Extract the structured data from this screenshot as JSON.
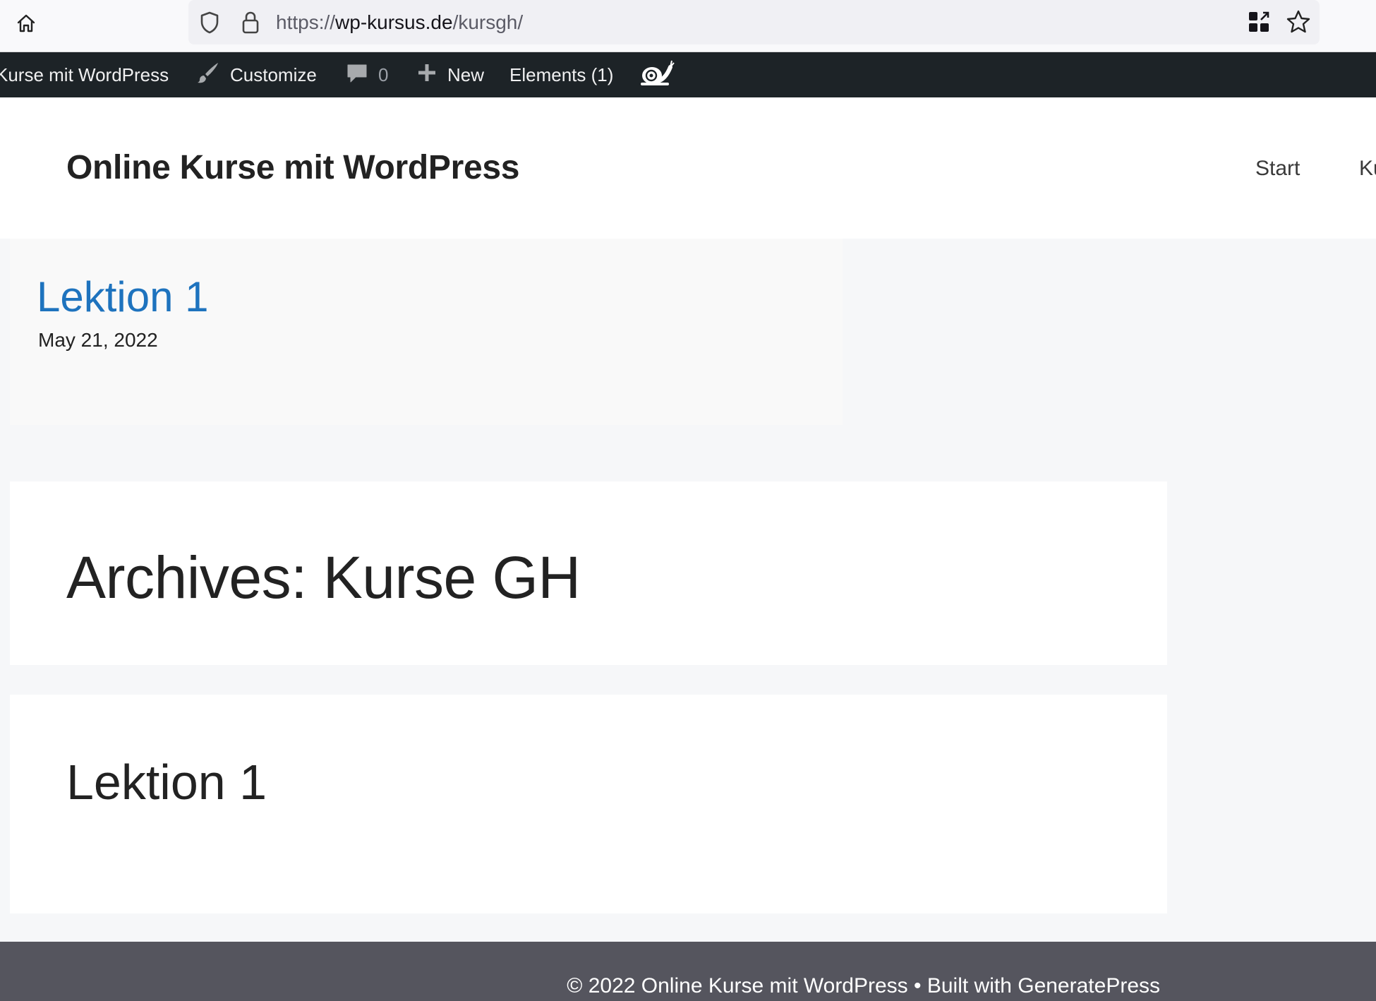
{
  "browser": {
    "url_scheme": "https://",
    "url_host": "wp-kursus.de",
    "url_path": "/kursgh/",
    "icons": [
      "home-icon",
      "shield-icon",
      "lock-icon",
      "qr-code-icon",
      "star-icon"
    ]
  },
  "adminbar": {
    "site_name": "Kurse mit WordPress",
    "customize_label": "Customize",
    "comments_count": "0",
    "new_label": "New",
    "elements_label": "Elements (1)",
    "icons": [
      "brush-icon",
      "comment-icon",
      "plus-icon",
      "snail-icon"
    ]
  },
  "header": {
    "site_title": "Online Kurse mit WordPress",
    "nav": [
      "Start",
      "Ku"
    ]
  },
  "preview": {
    "title": "Lektion 1",
    "date": "May 21, 2022"
  },
  "archive": {
    "title": "Archives: Kurse GH"
  },
  "post": {
    "title": "Lektion 1"
  },
  "footer": {
    "text": "© 2022 Online Kurse mit WordPress • Built with GeneratePress"
  },
  "colors": {
    "admin_bar_bg": "#1d2327",
    "link_blue": "#1e73be",
    "page_bg": "#f6f7f9",
    "footer_bg": "#55555e"
  }
}
